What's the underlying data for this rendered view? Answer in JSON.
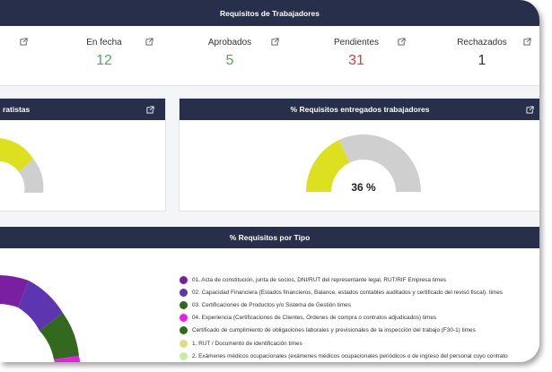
{
  "header": {
    "title": "Requisitos de Trabajadores"
  },
  "stats": [
    {
      "label": "En fecha",
      "value": "12",
      "color": "#4caf50"
    },
    {
      "label": "Aprobados",
      "value": "5",
      "color": "#4caf50"
    },
    {
      "label": "Pendientes",
      "value": "31",
      "color": "#e53935"
    },
    {
      "label": "Rechazados",
      "value": "1",
      "color": "#333333"
    }
  ],
  "card_left": {
    "title": "ratistas"
  },
  "card_right": {
    "title": "% Requisitos entregados trabajadores",
    "percent": "36 %",
    "percent_value": 36
  },
  "section_tipo": {
    "title": "% Requisitos por Tipo"
  },
  "legend": [
    {
      "label": "01. Acta de constitución, junta de socios, DNI/RUT del representante legal, RUT/RIF Empresa times",
      "color": "#7b1fa2"
    },
    {
      "label": "02. Capacidad Financiera (Estados financieros, Balance, estados contables auditados y certificado del revisó fiscal). times",
      "color": "#5e35b1"
    },
    {
      "label": "03. Certificaciones de Productos y/o Sistema de Gestión times",
      "color": "#33691e"
    },
    {
      "label": "04. Experiencia (Certificaciones de Clientes, Órdenes de compra o contratos adjudicados) times",
      "color": "#e91ee8"
    },
    {
      "label": "Certificado de cumplimiento de obligaciones laborales y previsionales de la inspección del trabajo (F30-1) times",
      "color": "#2e6b1c"
    },
    {
      "label": "1. RUT / Documento de identificación times",
      "color": "#dde07a"
    },
    {
      "label": "2. Exámenes médicos ocupacionales (exámenes médicos ocupacionales periódicos o de ingreso del personal cuyo contrato",
      "color": "#c5ef9e"
    }
  ],
  "colors": {
    "header_bg": "#272f4a",
    "gauge_fill": "#dde01e",
    "gauge_rest": "#cfcfcf"
  }
}
